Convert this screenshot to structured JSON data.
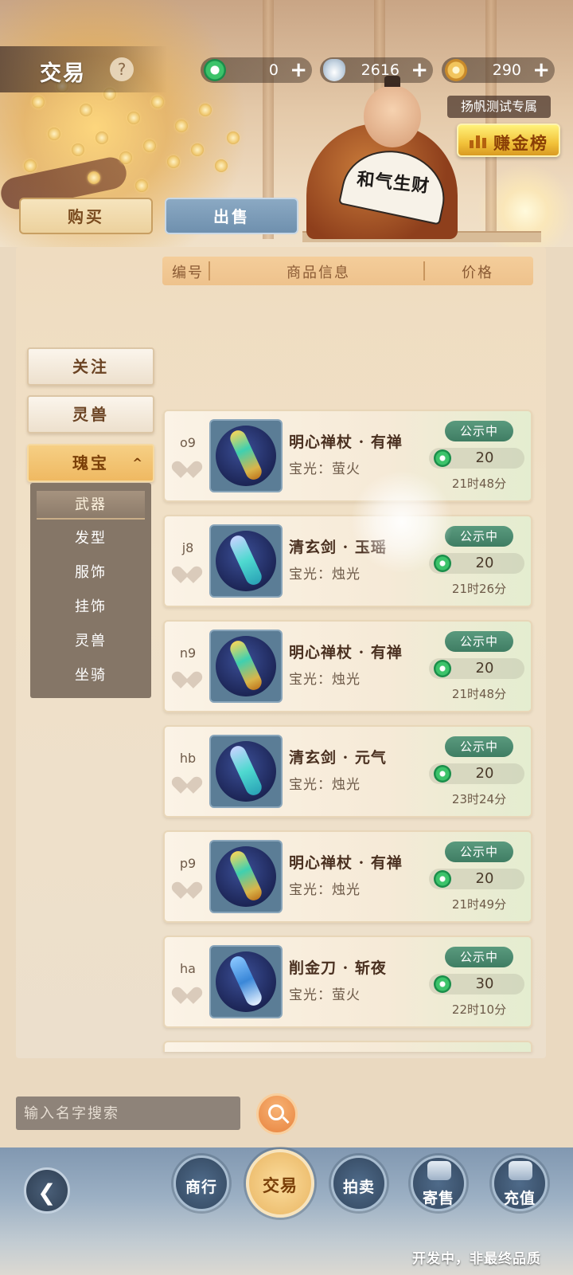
{
  "header": {
    "title": "交易",
    "help": "?",
    "currencies": [
      {
        "icon": "jade-icon",
        "value": "0",
        "plus": "+"
      },
      {
        "icon": "silver-ingot-icon",
        "value": "2616",
        "plus": "+"
      },
      {
        "icon": "gold-coin-icon",
        "value": "290",
        "plus": "+"
      }
    ],
    "test_tag": "扬帆测试专属",
    "rank_button": "赚金榜",
    "fan_text": "和气生财"
  },
  "tabs": {
    "buy": "购买",
    "sell": "出售"
  },
  "columns": {
    "id": "编号",
    "info": "商品信息",
    "price": "价格"
  },
  "sidebar": {
    "items": [
      {
        "label": "关注"
      },
      {
        "label": "灵兽"
      },
      {
        "label": "瑰宝",
        "caret": "^"
      }
    ],
    "submenu": [
      "武器",
      "发型",
      "服饰",
      "挂饰",
      "灵兽",
      "坐骑"
    ]
  },
  "listings": [
    {
      "code": "o9",
      "name": "明心禅杖 · 有禅",
      "glow": "宝光：萤火",
      "status": "公示中",
      "price": "20",
      "time": "21时48分",
      "type": "staff"
    },
    {
      "code": "j8",
      "name": "清玄剑 · 玉瑶",
      "glow": "宝光：烛光",
      "status": "公示中",
      "price": "20",
      "time": "21时26分",
      "type": "sword"
    },
    {
      "code": "n9",
      "name": "明心禅杖 · 有禅",
      "glow": "宝光：烛光",
      "status": "公示中",
      "price": "20",
      "time": "21时48分",
      "type": "staff"
    },
    {
      "code": "hb",
      "name": "清玄剑 · 元气",
      "glow": "宝光：烛光",
      "status": "公示中",
      "price": "20",
      "time": "23时24分",
      "type": "sword"
    },
    {
      "code": "p9",
      "name": "明心禅杖 · 有禅",
      "glow": "宝光：烛光",
      "status": "公示中",
      "price": "20",
      "time": "21时49分",
      "type": "staff"
    },
    {
      "code": "ha",
      "name": "削金刀 · 斩夜",
      "glow": "宝光：萤火",
      "status": "公示中",
      "price": "30",
      "time": "22时10分",
      "type": "blade"
    }
  ],
  "search": {
    "placeholder": "输入名字搜索"
  },
  "bottom_nav": [
    {
      "label": "商行"
    },
    {
      "label": "交易"
    },
    {
      "label": "拍卖"
    },
    {
      "label": "寄售"
    },
    {
      "label": "充值"
    }
  ],
  "footnote": "开发中，非最终品质",
  "colors": {
    "accent": "#efb962",
    "status_green": "#3f7d63",
    "panel": "#efdcc0"
  }
}
